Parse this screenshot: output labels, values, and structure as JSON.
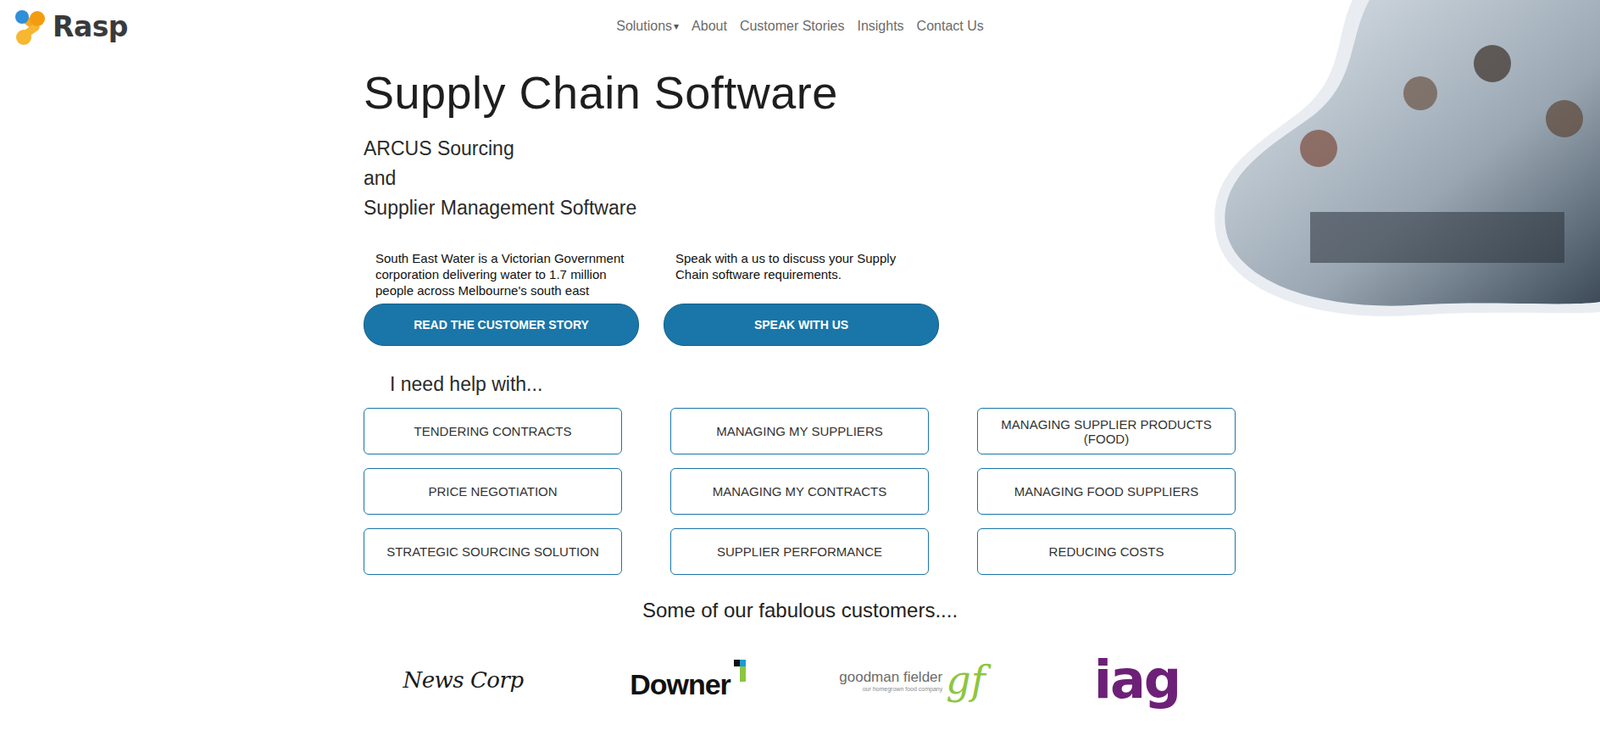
{
  "logo": {
    "text": "Rasp"
  },
  "nav": [
    {
      "label": "Solutions",
      "caret": "▾"
    },
    {
      "label": "About"
    },
    {
      "label": "Customer Stories"
    },
    {
      "label": "Insights"
    },
    {
      "label": "Contact Us"
    }
  ],
  "hero": {
    "title": "Supply Chain Software",
    "subtitle": [
      "ARCUS Sourcing",
      "and",
      "Supplier Management Software"
    ]
  },
  "cards": [
    {
      "text": "South East Water is a Victorian Government corporation delivering water to 1.7 million people across Melbourne's south east",
      "button": "READ THE CUSTOMER STORY"
    },
    {
      "text": "Speak with a us to discuss your Supply Chain software requirements.",
      "button": "SPEAK WITH US"
    }
  ],
  "help": {
    "heading": "I need help with...",
    "items": [
      "TENDERING CONTRACTS",
      "MANAGING MY SUPPLIERS",
      "MANAGING SUPPLIER PRODUCTS (FOOD)",
      "PRICE NEGOTIATION",
      "MANAGING MY CONTRACTS",
      "MANAGING FOOD SUPPLIERS",
      "STRATEGIC SOURCING SOLUTION",
      "SUPPLIER PERFORMANCE",
      "REDUCING COSTS"
    ]
  },
  "customers": {
    "heading": "Some of our fabulous customers....",
    "logos": [
      {
        "name": "News Corp",
        "kind": "script",
        "color": "#1a1a1a"
      },
      {
        "name": "Downer",
        "kind": "bold",
        "color": "#111111"
      },
      {
        "name": "goodman fielder",
        "kind": "mark",
        "mark": "gf",
        "tagline": "our homegrown food company",
        "color": "#8dc63f"
      },
      {
        "name": "iag",
        "kind": "big",
        "color": "#6d2077"
      }
    ]
  }
}
